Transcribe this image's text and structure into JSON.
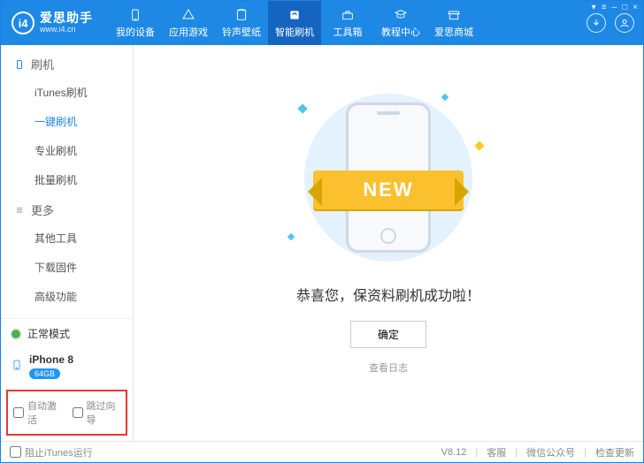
{
  "brand": {
    "badge": "i4",
    "title": "爱思助手",
    "url": "www.i4.cn"
  },
  "nav": {
    "tabs": [
      {
        "label": "我的设备"
      },
      {
        "label": "应用游戏"
      },
      {
        "label": "铃声壁纸"
      },
      {
        "label": "智能刷机"
      },
      {
        "label": "工具箱"
      },
      {
        "label": "教程中心"
      },
      {
        "label": "爱思商城"
      }
    ],
    "active_index": 3
  },
  "sidebar": {
    "groups": [
      {
        "title": "刷机",
        "items": [
          "iTunes刷机",
          "一键刷机",
          "专业刷机",
          "批量刷机"
        ],
        "active_index": 1
      },
      {
        "title": "更多",
        "items": [
          "其他工具",
          "下载固件",
          "高级功能"
        ],
        "active_index": -1
      }
    ],
    "status": "正常模式",
    "device": {
      "name": "iPhone 8",
      "storage": "64GB"
    },
    "checkboxes": {
      "auto_activate": "自动激活",
      "skip_guide": "跳过向导"
    }
  },
  "main": {
    "ribbon": "NEW",
    "message": "恭喜您，保资料刷机成功啦！",
    "ok": "确定",
    "view_log": "查看日志"
  },
  "footer": {
    "block_itunes": "阻止iTunes运行",
    "version": "V8.12",
    "links": [
      "客服",
      "微信公众号",
      "检查更新"
    ]
  }
}
